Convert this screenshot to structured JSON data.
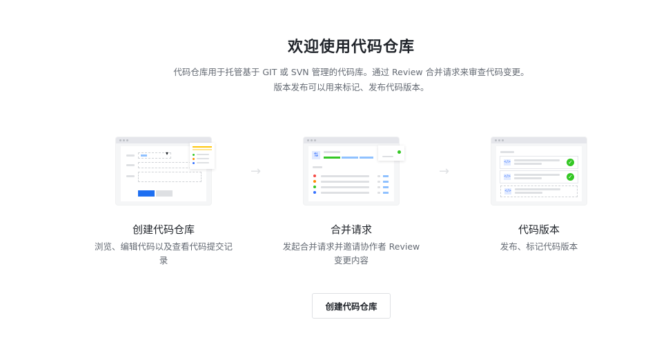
{
  "page": {
    "title": "欢迎使用代码仓库",
    "description_line1": "代码仓库用于托管基于 GIT 或 SVN 管理的代码库。通过 Review 合并请求来审查代码变更。",
    "description_line2": "版本发布可以用来标记、发布代码版本。"
  },
  "cards": [
    {
      "title": "创建代码仓库",
      "description": "浏览、编辑代码以及查看代码提交记录"
    },
    {
      "title": "合并请求",
      "description": "发起合并请求并邀请协作者 Review 变更内容"
    },
    {
      "title": "代码版本",
      "description": "发布、标记代码版本"
    }
  ],
  "arrows": [
    "→",
    "→"
  ],
  "icons": {
    "dropdown": "▾",
    "merge": "⇅",
    "code": "</>",
    "check": "✓"
  },
  "colors": {
    "primary": "#1e6ff1",
    "green": "#34c724",
    "orange": "#ff8800",
    "red": "#f54a45",
    "yellow": "#ffc60a",
    "blue": "#3370ff"
  },
  "actions": {
    "create_label": "创建代码仓库"
  }
}
